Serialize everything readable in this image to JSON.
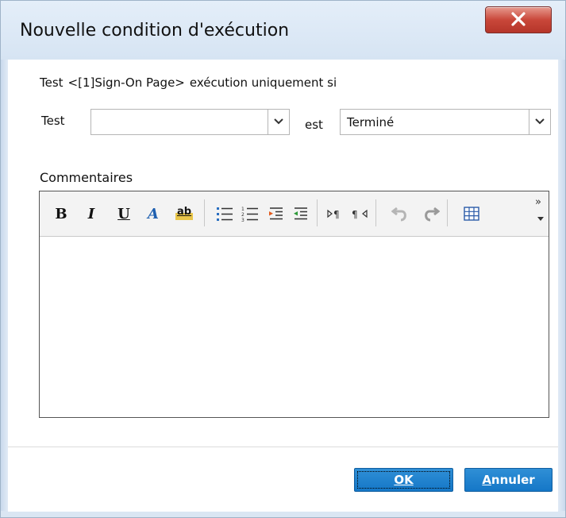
{
  "window": {
    "title": "Nouvelle condition d'exécution"
  },
  "condition": {
    "prefix": "Test",
    "test_name": "<[1]Sign-On Page>",
    "suffix": "exécution uniquement si"
  },
  "test_field": {
    "label": "Test",
    "value": ""
  },
  "state_field": {
    "label": "est",
    "value": "Terminé"
  },
  "comments": {
    "label": "Commentaires",
    "body": ""
  },
  "toolbar": {
    "bold": "B",
    "italic": "I",
    "underline": "U",
    "font_color": "A",
    "highlight": "ab",
    "more": "»"
  },
  "buttons": {
    "ok": "OK",
    "cancel": "Annuler"
  },
  "colors": {
    "accent": "#1577c7",
    "close": "#c9473a",
    "frame": "#dfe9f5"
  }
}
